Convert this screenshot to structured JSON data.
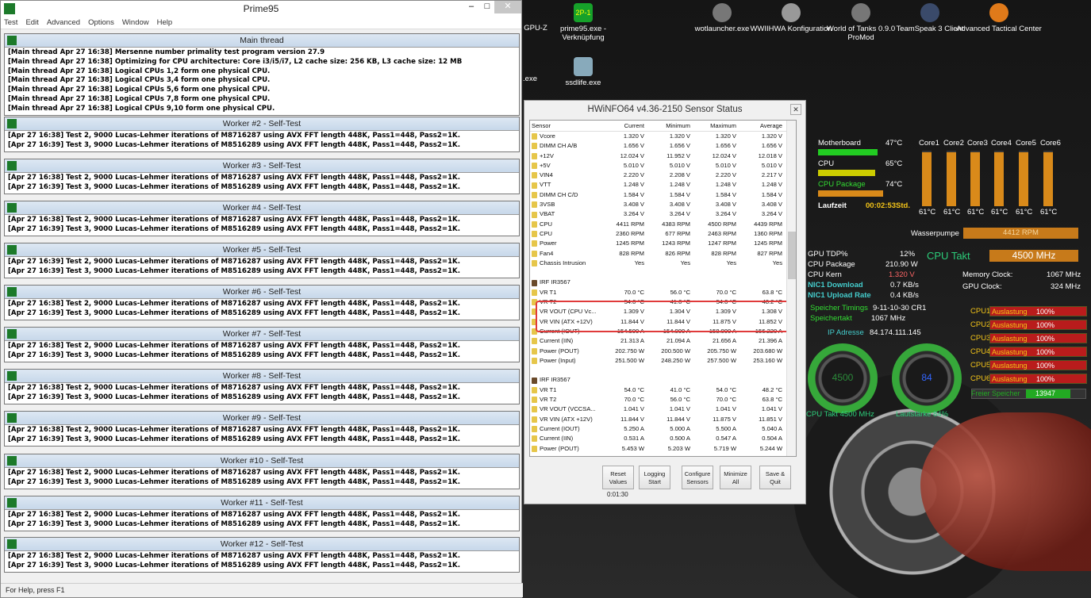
{
  "prime95": {
    "title": "Prime95",
    "menu": [
      "Test",
      "Edit",
      "Advanced",
      "Options",
      "Window",
      "Help"
    ],
    "status": "For Help, press F1",
    "main": {
      "title": "Main thread",
      "lines": [
        "[Main thread Apr 27 16:38] Mersenne number primality test program version 27.9",
        "[Main thread Apr 27 16:38] Optimizing for CPU architecture: Core i3/i5/i7, L2 cache size: 256 KB, L3 cache size: 12 MB",
        "[Main thread Apr 27 16:38] Logical CPUs 1,2 form one physical CPU.",
        "[Main thread Apr 27 16:38] Logical CPUs 3,4 form one physical CPU.",
        "[Main thread Apr 27 16:38] Logical CPUs 5,6 form one physical CPU.",
        "[Main thread Apr 27 16:38] Logical CPUs 7,8 form one physical CPU.",
        "[Main thread Apr 27 16:38] Logical CPUs 9,10 form one physical CPU."
      ]
    },
    "workers": [
      {
        "title": "Worker #2 - Self-Test",
        "lines": [
          "[Apr 27 16:38] Test 2, 9000 Lucas-Lehmer iterations of M8716287 using AVX FFT length 448K, Pass1=448, Pass2=1K.",
          "[Apr 27 16:39] Test 3, 9000 Lucas-Lehmer iterations of M8516289 using AVX FFT length 448K, Pass1=448, Pass2=1K."
        ]
      },
      {
        "title": "Worker #3 - Self-Test",
        "lines": [
          "[Apr 27 16:38] Test 2, 9000 Lucas-Lehmer iterations of M8716287 using AVX FFT length 448K, Pass1=448, Pass2=1K.",
          "[Apr 27 16:39] Test 3, 9000 Lucas-Lehmer iterations of M8516289 using AVX FFT length 448K, Pass1=448, Pass2=1K."
        ]
      },
      {
        "title": "Worker #4 - Self-Test",
        "lines": [
          "[Apr 27 16:38] Test 2, 9000 Lucas-Lehmer iterations of M8716287 using AVX FFT length 448K, Pass1=448, Pass2=1K.",
          "[Apr 27 16:39] Test 3, 9000 Lucas-Lehmer iterations of M8516289 using AVX FFT length 448K, Pass1=448, Pass2=1K."
        ]
      },
      {
        "title": "Worker #5 - Self-Test",
        "lines": [
          "[Apr 27 16:39] Test 2, 9000 Lucas-Lehmer iterations of M8716287 using AVX FFT length 448K, Pass1=448, Pass2=1K.",
          "[Apr 27 16:39] Test 3, 9000 Lucas-Lehmer iterations of M8516289 using AVX FFT length 448K, Pass1=448, Pass2=1K."
        ]
      },
      {
        "title": "Worker #6 - Self-Test",
        "lines": [
          "[Apr 27 16:38] Test 2, 9000 Lucas-Lehmer iterations of M8716287 using AVX FFT length 448K, Pass1=448, Pass2=1K.",
          "[Apr 27 16:39] Test 3, 9000 Lucas-Lehmer iterations of M8516289 using AVX FFT length 448K, Pass1=448, Pass2=1K."
        ]
      },
      {
        "title": "Worker #7 - Self-Test",
        "lines": [
          "[Apr 27 16:38] Test 2, 9000 Lucas-Lehmer iterations of M8716287 using AVX FFT length 448K, Pass1=448, Pass2=1K.",
          "[Apr 27 16:39] Test 3, 9000 Lucas-Lehmer iterations of M8516289 using AVX FFT length 448K, Pass1=448, Pass2=1K."
        ]
      },
      {
        "title": "Worker #8 - Self-Test",
        "lines": [
          "[Apr 27 16:38] Test 2, 9000 Lucas-Lehmer iterations of M8716287 using AVX FFT length 448K, Pass1=448, Pass2=1K.",
          "[Apr 27 16:39] Test 3, 9000 Lucas-Lehmer iterations of M8516289 using AVX FFT length 448K, Pass1=448, Pass2=1K."
        ]
      },
      {
        "title": "Worker #9 - Self-Test",
        "lines": [
          "[Apr 27 16:38] Test 2, 9000 Lucas-Lehmer iterations of M8716287 using AVX FFT length 448K, Pass1=448, Pass2=1K.",
          "[Apr 27 16:39] Test 3, 9000 Lucas-Lehmer iterations of M8516289 using AVX FFT length 448K, Pass1=448, Pass2=1K."
        ]
      },
      {
        "title": "Worker #10 - Self-Test",
        "lines": [
          "[Apr 27 16:38] Test 2, 9000 Lucas-Lehmer iterations of M8716287 using AVX FFT length 448K, Pass1=448, Pass2=1K.",
          "[Apr 27 16:39] Test 3, 9000 Lucas-Lehmer iterations of M8516289 using AVX FFT length 448K, Pass1=448, Pass2=1K."
        ]
      },
      {
        "title": "Worker #11 - Self-Test",
        "lines": [
          "[Apr 27 16:38] Test 2, 9000 Lucas-Lehmer iterations of M8716287 using AVX FFT length 448K, Pass1=448, Pass2=1K.",
          "[Apr 27 16:39] Test 3, 9000 Lucas-Lehmer iterations of M8516289 using AVX FFT length 448K, Pass1=448, Pass2=1K."
        ]
      },
      {
        "title": "Worker #12 - Self-Test",
        "lines": [
          "[Apr 27 16:38] Test 2, 9000 Lucas-Lehmer iterations of M8716287 using AVX FFT length 448K, Pass1=448, Pass2=1K.",
          "[Apr 27 16:39] Test 3, 9000 Lucas-Lehmer iterations of M8516289 using AVX FFT length 448K, Pass1=448, Pass2=1K."
        ]
      }
    ]
  },
  "desktop": {
    "icons": [
      "GPU-Z",
      "prime95.exe - Verknüpfung",
      "wotlauncher.exe",
      "WWIIHWA Konfiguration",
      "World of Tanks 0.9.0 ProMod",
      "TeamSpeak 3 Client",
      "Advanced Tactical Center",
      ".exe",
      "ssdlife.exe"
    ]
  },
  "hwinfo": {
    "title": "HWiNFO64 v4.36-2150 Sensor Status",
    "columns": [
      "Sensor",
      "Current",
      "Minimum",
      "Maximum",
      "Average"
    ],
    "rows": [
      [
        "Vcore",
        "1.320 V",
        "1.320 V",
        "1.320 V",
        "1.320 V"
      ],
      [
        "DIMM CH A/B",
        "1.656 V",
        "1.656 V",
        "1.656 V",
        "1.656 V"
      ],
      [
        "+12V",
        "12.024 V",
        "11.952 V",
        "12.024 V",
        "12.018 V"
      ],
      [
        "+5V",
        "5.010 V",
        "5.010 V",
        "5.010 V",
        "5.010 V"
      ],
      [
        "VIN4",
        "2.220 V",
        "2.208 V",
        "2.220 V",
        "2.217 V"
      ],
      [
        "VTT",
        "1.248 V",
        "1.248 V",
        "1.248 V",
        "1.248 V"
      ],
      [
        "DIMM CH C/D",
        "1.584 V",
        "1.584 V",
        "1.584 V",
        "1.584 V"
      ],
      [
        "3VSB",
        "3.408 V",
        "3.408 V",
        "3.408 V",
        "3.408 V"
      ],
      [
        "VBAT",
        "3.264 V",
        "3.264 V",
        "3.264 V",
        "3.264 V"
      ],
      [
        "CPU",
        "4411 RPM",
        "4383 RPM",
        "4500 RPM",
        "4439 RPM"
      ],
      [
        "CPU",
        "2360 RPM",
        "677 RPM",
        "2463 RPM",
        "1360 RPM"
      ],
      [
        "Power",
        "1245 RPM",
        "1243 RPM",
        "1247 RPM",
        "1245 RPM"
      ],
      [
        "Fan4",
        "828 RPM",
        "826 RPM",
        "828 RPM",
        "827 RPM"
      ],
      [
        "Chassis Intrusion",
        "Yes",
        "Yes",
        "Yes",
        "Yes"
      ],
      [
        "",
        "",
        "",
        "",
        ""
      ],
      [
        "IRF IR3567",
        "",
        "",
        "",
        ""
      ],
      [
        "VR T1",
        "70.0 °C",
        "56.0 °C",
        "70.0 °C",
        "63.8 °C"
      ],
      [
        "VR T2",
        "54.0 °C",
        "41.0 °C",
        "54.0 °C",
        "48.2 °C"
      ],
      [
        "VR VOUT (CPU Vc...",
        "1.309 V",
        "1.304 V",
        "1.309 V",
        "1.308 V"
      ],
      [
        "VR VIN (ATX +12V)",
        "11.844 V",
        "11.844 V",
        "11.875 V",
        "11.852 V"
      ],
      [
        "Current (IOUT)",
        "154.500 A",
        "154.000 A",
        "158.000 A",
        "156.220 A"
      ],
      [
        "Current (IIN)",
        "21.313 A",
        "21.094 A",
        "21.656 A",
        "21.396 A"
      ],
      [
        "Power (POUT)",
        "202.750 W",
        "200.500 W",
        "205.750 W",
        "203.680 W"
      ],
      [
        "Power (Input)",
        "251.500 W",
        "248.250 W",
        "257.500 W",
        "253.160 W"
      ],
      [
        "",
        "",
        "",
        "",
        ""
      ],
      [
        "IRF IR3567",
        "",
        "",
        "",
        ""
      ],
      [
        "VR T1",
        "54.0 °C",
        "41.0 °C",
        "54.0 °C",
        "48.2 °C"
      ],
      [
        "VR T2",
        "70.0 °C",
        "56.0 °C",
        "70.0 °C",
        "63.8 °C"
      ],
      [
        "VR VOUT (VCCSA...",
        "1.041 V",
        "1.041 V",
        "1.041 V",
        "1.041 V"
      ],
      [
        "VR VIN (ATX +12V)",
        "11.844 V",
        "11.844 V",
        "11.875 V",
        "11.851 V"
      ],
      [
        "Current (IOUT)",
        "5.250 A",
        "5.000 A",
        "5.500 A",
        "5.040 A"
      ],
      [
        "Current (IIN)",
        "0.531 A",
        "0.500 A",
        "0.547 A",
        "0.504 A"
      ],
      [
        "Power (POUT)",
        "5.453 W",
        "5.203 W",
        "5.719 W",
        "5.244 W"
      ]
    ],
    "buttons": [
      "Reset Values",
      "Logging Start",
      "Configure Sensors",
      "Minimize All",
      "Save & Quit"
    ],
    "timer": "0:01:30"
  },
  "gadget": {
    "motherboard": "Motherboard",
    "mb_temp": "47°C",
    "cpu": "CPU",
    "cpu_temp": "65°C",
    "cpu_pkg": "CPU Package",
    "pkg_temp": "74°C",
    "laufzeit": "Laufzeit",
    "laufzeit_val": "00:02:53",
    "laufzeit_unit": "Std.",
    "cores": [
      "Core1",
      "Core2",
      "Core3",
      "Core4",
      "Core5",
      "Core6"
    ],
    "core_temps": [
      "61°C",
      "61°C",
      "61°C",
      "61°C",
      "61°C",
      "61°C"
    ],
    "wasserpumpe": "Wasserpumpe",
    "pump": "4412 RPM",
    "gpu_tdp": "GPU TDP%",
    "gpu_tdp_val": "12%",
    "cpu_package": "CPU Package",
    "cpu_package_val": "210.90 W",
    "cpu_kern": "CPU Kern",
    "cpu_kern_val": "1.320 V",
    "nic_dl": "NIC1 Download",
    "nic_dl_val": "0.7 KB/s",
    "nic_ul": "NIC1 Upload Rate",
    "nic_ul_val": "0.4 KB/s",
    "cpu_takt": "CPU Takt",
    "cpu_takt_val": "4500 MHz",
    "mem_clock": "Memory Clock:",
    "mem_clock_val": "1067 MHz",
    "gpu_clock": "GPU Clock:",
    "gpu_clock_val": "324 MHz",
    "timings": "Speicher Timings",
    "timings_val": "9-11-10-30 CR1",
    "speichertakt": "Speichertakt",
    "speichertakt_val": "1067 MHz",
    "ip": "IP Adresse",
    "ip_val": "84.174.111.145",
    "gauge1": "4500",
    "gauge2": "84",
    "gauge1_label": "CPU Takt  4500 MHz",
    "gauge2_label": "Lautstärke   84%",
    "cpus": [
      "CPU1",
      "CPU2",
      "CPU3",
      "CPU4",
      "CPU5",
      "CPU6"
    ],
    "auslastung": "Auslastung",
    "pct": "100%",
    "freier": "Freier Speicher",
    "freier_val": "13947"
  }
}
